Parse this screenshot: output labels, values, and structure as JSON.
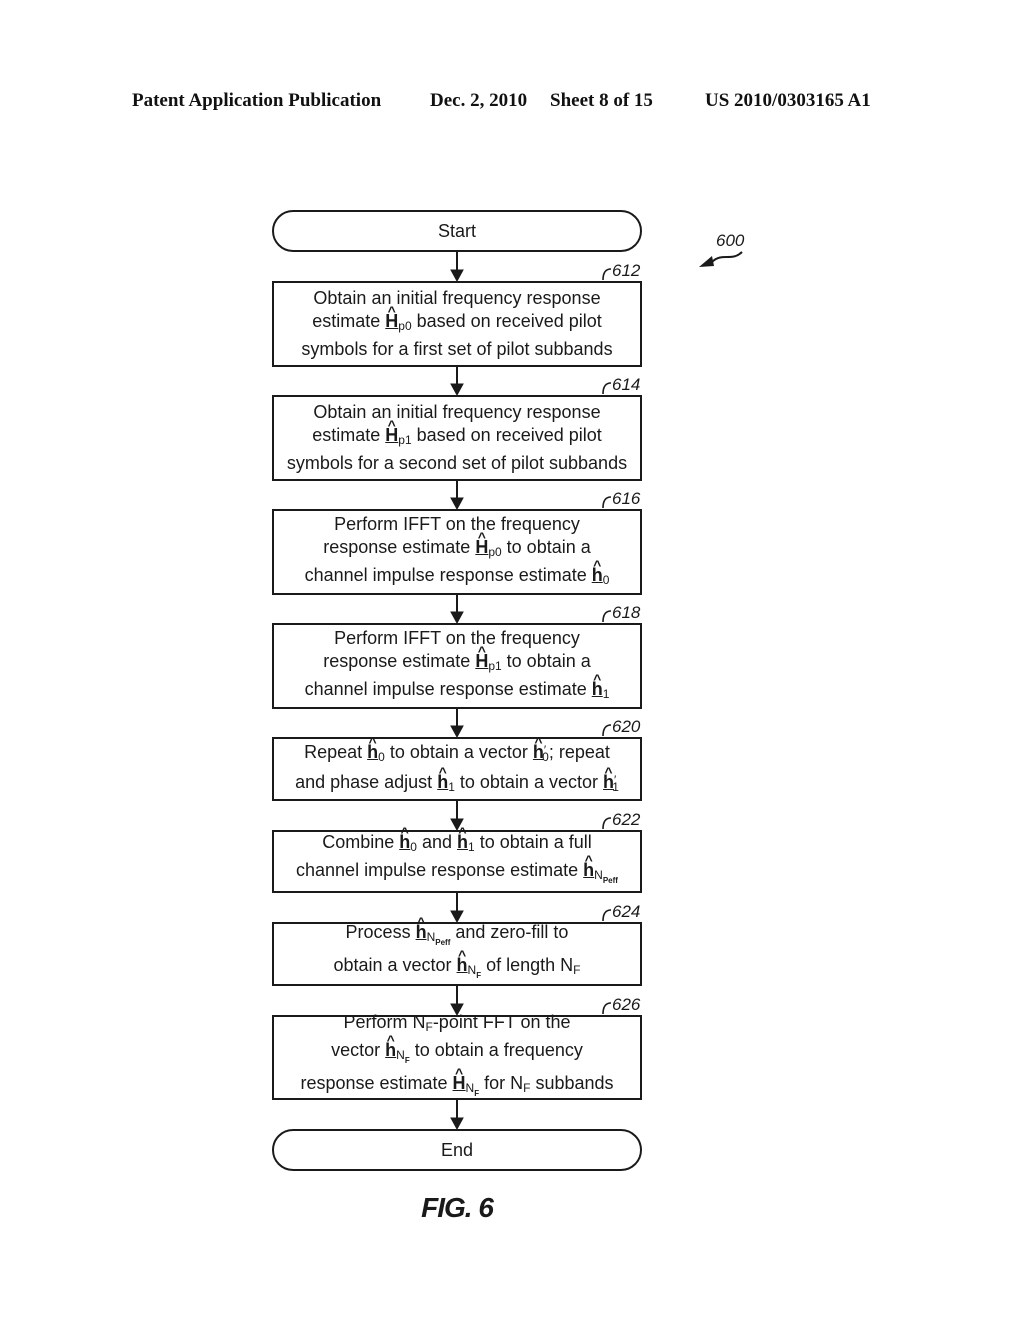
{
  "header": {
    "publication": "Patent Application Publication",
    "date": "Dec. 2, 2010",
    "sheet": "Sheet 8 of 15",
    "number": "US 2010/0303165 A1"
  },
  "diagram": {
    "ref": "600",
    "start": "Start",
    "end": "End",
    "figure_label": "FIG. 6",
    "steps": [
      {
        "ref": "612",
        "lines": [
          "Obtain an initial frequency response",
          [
            "estimate ",
            {
              "sym": "H",
              "sub": "p0"
            },
            " based on received pilot"
          ],
          "symbols for a first set of pilot subbands"
        ]
      },
      {
        "ref": "614",
        "lines": [
          "Obtain an initial frequency response",
          [
            "estimate ",
            {
              "sym": "H",
              "sub": "p1"
            },
            " based on received pilot"
          ],
          "symbols for a second set of pilot subbands"
        ]
      },
      {
        "ref": "616",
        "lines": [
          "Perform IFFT on the frequency",
          [
            "response estimate ",
            {
              "sym": "H",
              "sub": "p0"
            },
            " to obtain a"
          ],
          [
            "channel impulse response estimate ",
            {
              "sym": "h",
              "sub": "0"
            }
          ]
        ]
      },
      {
        "ref": "618",
        "lines": [
          "Perform IFFT on the frequency",
          [
            "response estimate ",
            {
              "sym": "H",
              "sub": "p1"
            },
            " to obtain a"
          ],
          [
            "channel impulse response estimate ",
            {
              "sym": "h",
              "sub": "1"
            }
          ]
        ]
      },
      {
        "ref": "620",
        "lines": [
          [
            "Repeat ",
            {
              "sym": "h",
              "sub": "0"
            },
            " to obtain a vector ",
            {
              "sym": "h",
              "sub": "0",
              "prime": true
            },
            ";  repeat"
          ],
          [
            "and phase adjust ",
            {
              "sym": "h",
              "sub": "1"
            },
            " to obtain a vector ",
            {
              "sym": "h",
              "sub": "1",
              "prime": true
            }
          ]
        ]
      },
      {
        "ref": "622",
        "lines": [
          [
            "Combine ",
            {
              "sym": "h",
              "sub": "0"
            },
            " and ",
            {
              "sym": "h",
              "sub": "1"
            },
            " to obtain a full"
          ],
          [
            "channel impulse response estimate ",
            {
              "sym": "h",
              "sub": "N",
              "sub2": "Peff"
            }
          ]
        ]
      },
      {
        "ref": "624",
        "lines": [
          [
            "Process ",
            {
              "sym": "h",
              "sub": "N",
              "sub2": "Peff"
            },
            " and zero-fill to"
          ],
          [
            "obtain a vector ",
            {
              "sym": "h",
              "sub": "N",
              "sub2": "F"
            },
            " of length N",
            {
              "plainsub": "F"
            }
          ]
        ]
      },
      {
        "ref": "626",
        "lines": [
          [
            "Perform N",
            {
              "plainsub": "F"
            },
            "-point FFT on the"
          ],
          [
            "vector ",
            {
              "sym": "h",
              "sub": "N",
              "sub2": "F"
            },
            " to obtain a frequency"
          ],
          [
            "response estimate ",
            {
              "sym": "H",
              "sub": "N",
              "sub2": "F"
            },
            " for N",
            {
              "plainsub": "F"
            },
            " subbands"
          ]
        ]
      }
    ]
  }
}
